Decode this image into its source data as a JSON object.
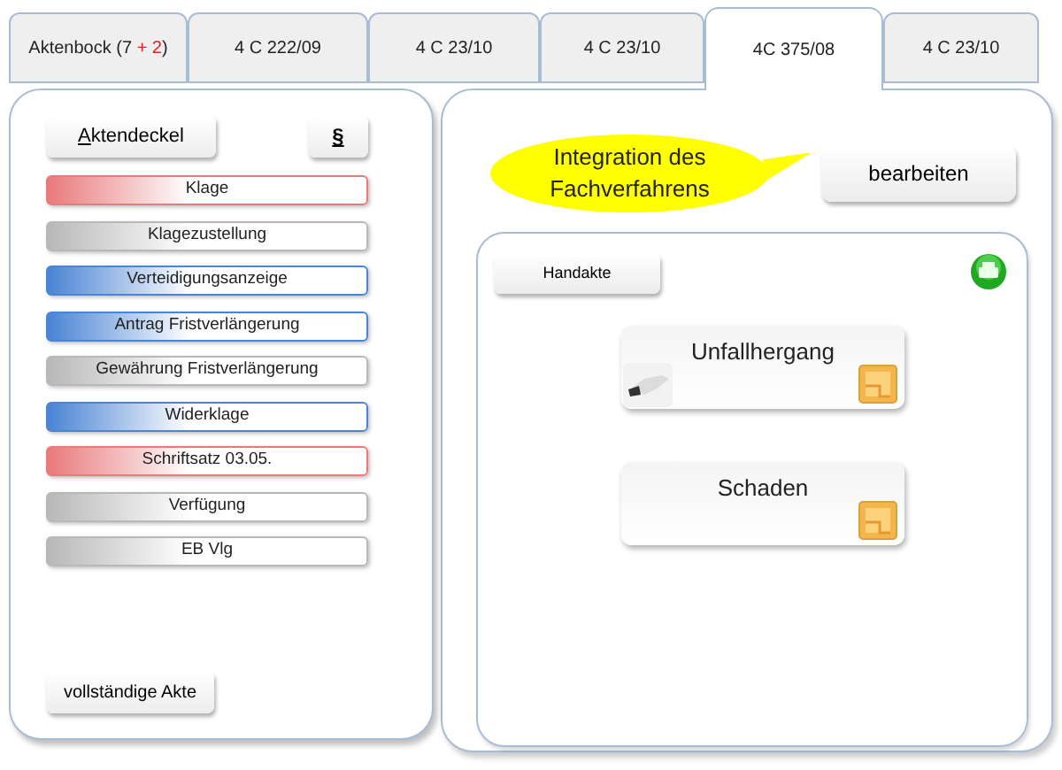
{
  "tabs": [
    {
      "parts": [
        {
          "text": "Aktenbock (7 ",
          "kind": "plain"
        },
        {
          "text": "+ 2",
          "kind": "alert"
        },
        {
          "text": ")",
          "kind": "plain"
        }
      ],
      "selected": false
    },
    {
      "parts": [
        {
          "text": "4 C 222/09",
          "kind": "plain"
        }
      ],
      "selected": false
    },
    {
      "parts": [
        {
          "text": "4 C 23/10",
          "kind": "plain"
        }
      ],
      "selected": false
    },
    {
      "parts": [
        {
          "text": "4 C 23/10",
          "kind": "plain"
        }
      ],
      "selected": false
    },
    {
      "parts": [
        {
          "text": "4C 375/08",
          "kind": "plain"
        }
      ],
      "selected": true
    },
    {
      "parts": [
        {
          "text": "4 C 23/10",
          "kind": "plain"
        }
      ],
      "selected": false
    }
  ],
  "left_panel": {
    "cover_button": {
      "label": "Aktendeckel",
      "first_letter_underlined": true
    },
    "law_button": {
      "label": "§"
    },
    "documents": [
      {
        "label": "Klage",
        "color": "#e87a7c"
      },
      {
        "label": "Klagezustellung",
        "color": "#b8b8b8"
      },
      {
        "label": "Verteidigungsanzeige",
        "color": "#4a84d4"
      },
      {
        "label": "Antrag Fristverlängerung",
        "color": "#4a84d4"
      },
      {
        "label": "Gewährung Fristverlängerung",
        "color": "#b8b8b8"
      },
      {
        "label": "Widerklage",
        "color": "#4a84d4"
      },
      {
        "label": "Schriftsatz 03.05.",
        "color": "#e87a7c"
      },
      {
        "label": "Verfügung",
        "color": "#b8b8b8"
      },
      {
        "label": "EB Vlg",
        "color": "#b8b8b8"
      }
    ],
    "full_file_button": {
      "label": "vollständige  Akte"
    }
  },
  "right_panel": {
    "callout": "Integration des Fachverfahrens",
    "edit_button": {
      "label": "bearbeiten"
    },
    "inner_panel": {
      "handakte_button": {
        "label": "Handakte"
      },
      "cards": [
        {
          "label": "Unfallhergang",
          "has_figure": true
        },
        {
          "label": "Schaden",
          "has_figure": false
        }
      ]
    }
  }
}
